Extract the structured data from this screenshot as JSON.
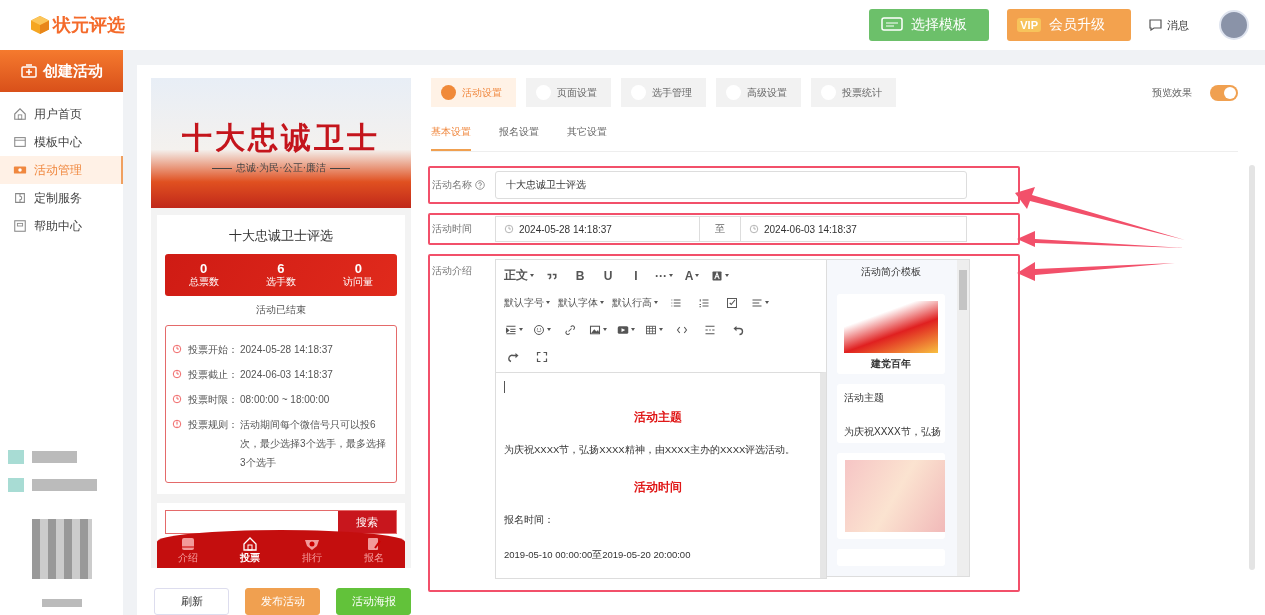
{
  "header": {
    "logo": "状元评选",
    "template_button": "选择模板",
    "vip_badge": "VIP",
    "vip_button": "会员升级",
    "messages": "消息"
  },
  "sidebar": {
    "create_button": "创建活动",
    "items": [
      {
        "label": "用户首页",
        "selected": false
      },
      {
        "label": "模板中心",
        "selected": false
      },
      {
        "label": "活动管理",
        "selected": true
      },
      {
        "label": "定制服务",
        "selected": false
      },
      {
        "label": "帮助中心",
        "selected": false
      }
    ]
  },
  "preview": {
    "banner_title": "十大忠诚卫士",
    "banner_subtitle": "忠诚·为民·公正·廉洁",
    "activity_name": "十大忠诚卫士评选",
    "stats": [
      {
        "value": "0",
        "label": "总票数"
      },
      {
        "value": "6",
        "label": "选手数"
      },
      {
        "value": "0",
        "label": "访问量"
      }
    ],
    "status": "活动已结束",
    "info": [
      {
        "kind": "clock",
        "label": "投票开始：",
        "value": "2024-05-28 14:18:37"
      },
      {
        "kind": "clock",
        "label": "投票截止：",
        "value": "2024-06-03 14:18:37"
      },
      {
        "kind": "clock",
        "label": "投票时限：",
        "value": "08:00:00 ~ 18:00:00"
      },
      {
        "kind": "alert",
        "label": "投票规则：",
        "value": "活动期间每个微信号只可以投6次，最少选择3个选手，最多选择3个选手"
      }
    ],
    "search_button": "搜索",
    "nav": [
      {
        "label": "介绍",
        "selected": false
      },
      {
        "label": "投票",
        "selected": true
      },
      {
        "label": "排行",
        "selected": false
      },
      {
        "label": "报名",
        "selected": false
      }
    ]
  },
  "actions": [
    {
      "label": "刷新",
      "kind": "plain"
    },
    {
      "label": "发布活动",
      "kind": "orange"
    },
    {
      "label": "活动海报",
      "kind": "green"
    }
  ],
  "tabs": [
    {
      "label": "活动设置",
      "selected": true
    },
    {
      "label": "页面设置",
      "selected": false
    },
    {
      "label": "选手管理",
      "selected": false
    },
    {
      "label": "高级设置",
      "selected": false
    },
    {
      "label": "投票统计",
      "selected": false
    }
  ],
  "preview_toggle": {
    "label": "预览效果",
    "on": true
  },
  "subtabs": [
    {
      "label": "基本设置",
      "selected": true
    },
    {
      "label": "报名设置",
      "selected": false
    },
    {
      "label": "其它设置",
      "selected": false
    }
  ],
  "form": {
    "name_label": "活动名称",
    "name_value": "十大忠诚卫士评选",
    "time_label": "活动时间",
    "start": "2024-05-28 14:18:37",
    "separator": "至",
    "end": "2024-06-03 14:18:37",
    "intro_label": "活动介绍"
  },
  "toolbar": [
    [
      {
        "kind": "text",
        "label": "正文",
        "dropdown": true
      },
      {
        "kind": "quote",
        "dropdown": false
      },
      {
        "kind": "text",
        "label": "B",
        "dropdown": false
      },
      {
        "kind": "text",
        "label": "U",
        "dropdown": false
      },
      {
        "kind": "text",
        "label": "I",
        "dropdown": false
      },
      {
        "kind": "text",
        "label": "···",
        "dropdown": true
      },
      {
        "kind": "text",
        "label": "A",
        "dropdown": true
      },
      {
        "kind": "bgcolor",
        "dropdown": true
      }
    ],
    [
      {
        "kind": "text",
        "label": "默认字号",
        "dropdown": true
      },
      {
        "kind": "text",
        "label": "默认字体",
        "dropdown": true
      },
      {
        "kind": "text",
        "label": "默认行高",
        "dropdown": true
      },
      {
        "kind": "ul",
        "dropdown": false
      },
      {
        "kind": "ol",
        "dropdown": false
      },
      {
        "kind": "todo",
        "dropdown": false
      },
      {
        "kind": "align",
        "dropdown": true
      }
    ],
    [
      {
        "kind": "indent",
        "dropdown": true
      },
      {
        "kind": "emoji",
        "dropdown": true
      },
      {
        "kind": "link",
        "dropdown": false
      },
      {
        "kind": "image",
        "dropdown": true
      },
      {
        "kind": "video",
        "dropdown": true
      },
      {
        "kind": "table",
        "dropdown": true
      },
      {
        "kind": "code",
        "dropdown": false
      },
      {
        "kind": "divider",
        "dropdown": false
      },
      {
        "kind": "undo",
        "dropdown": false
      }
    ],
    [
      {
        "kind": "redo",
        "dropdown": false
      },
      {
        "kind": "fullscreen",
        "dropdown": false
      }
    ]
  ],
  "editor": [
    {
      "kind": "cursor"
    },
    {
      "kind": "heading",
      "text": "活动主题"
    },
    {
      "kind": "text",
      "text": "为庆祝XXXX节，弘扬XXXX精神，由XXXX主办的XXXX评选活动。"
    },
    {
      "kind": "heading",
      "text": "活动时间"
    },
    {
      "kind": "text",
      "text": "报名时间："
    },
    {
      "kind": "text",
      "text": "2019-05-10 00:00:00至2019-05-20 20:00:00"
    }
  ],
  "templates": {
    "title": "活动简介模板",
    "items": [
      {
        "kind": "party",
        "caption": "建党百年"
      },
      {
        "kind": "text",
        "heading": "活动主题",
        "text": "为庆祝XXXX节，弘扬"
      },
      {
        "kind": "pink"
      },
      {
        "kind": "blank"
      }
    ]
  }
}
